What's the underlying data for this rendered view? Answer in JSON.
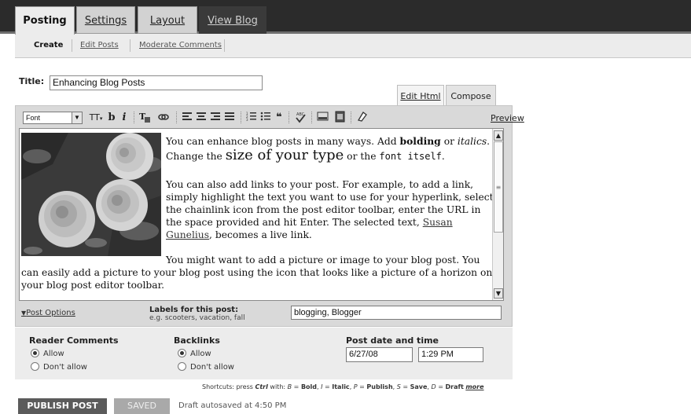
{
  "tabs": {
    "posting": "Posting",
    "settings": "Settings",
    "layout": "Layout",
    "view_blog": "View Blog"
  },
  "subtabs": {
    "create": "Create",
    "edit_posts": "Edit Posts",
    "moderate_comments": "Moderate Comments"
  },
  "title_field": {
    "label": "Title:",
    "value": "Enhancing Blog Posts"
  },
  "editor_modes": {
    "edit_html": "Edit Html",
    "compose": "Compose"
  },
  "toolbar": {
    "font_label": "Font",
    "font_size_icon": "TT",
    "bold": "b",
    "italic": "i",
    "preview": "Preview",
    "icons": [
      "font-select-icon",
      "font-size-icon",
      "bold-icon",
      "italic-icon",
      "text-color-icon",
      "link-icon",
      "align-left-icon",
      "align-center-icon",
      "align-right-icon",
      "justify-icon",
      "numbered-list-icon",
      "bullet-list-icon",
      "blockquote-icon",
      "spellcheck-icon",
      "image-icon",
      "video-icon",
      "remove-formatting-icon"
    ]
  },
  "content": {
    "p1_line1_a": "You can enhance blog posts in many ways. Add ",
    "p1_bold": "bolding",
    "p1_line1_b": " or ",
    "p1_italic": "italics",
    "p1_line1_c": ".",
    "p1_line2_a": "Change the ",
    "p1_big": "size of your type",
    "p1_line2_b": " or the ",
    "p1_mono": "font itself",
    "p1_line2_c": ".",
    "p2_line1": "You can also add links to your post. For example, to add a link,",
    "p2_line2": "simply highlight the text you want to use for your hyperlink, select",
    "p2_line3": "the chainlink icon from the post editor toolbar, enter the URL in",
    "p2_line4_a": "the space provided and hit Enter.  The selected text, ",
    "p2_link_a": "Susan",
    "p2_link_b": "Gunelius",
    "p2_line5_b": ", becomes a live link.",
    "p3_line1": "You might want to add a picture or image to your blog post. You",
    "p3_line2": "can easily add a picture to your blog post using the icon that looks like a picture of a horizon on",
    "p3_line3": "your blog post editor toolbar."
  },
  "labels": {
    "post_options": "Post Options",
    "title": "Labels for this post:",
    "hint": "e.g. scooters, vacation, fall",
    "value": "blogging, Blogger"
  },
  "options": {
    "reader_comments": {
      "heading": "Reader Comments",
      "allow": "Allow",
      "dont_allow": "Don't allow",
      "selected": "Allow"
    },
    "backlinks": {
      "heading": "Backlinks",
      "allow": "Allow",
      "dont_allow": "Don't allow",
      "selected": "Allow"
    },
    "post_date_time": {
      "heading": "Post date and time",
      "date": "6/27/08",
      "time": "1:29 PM"
    }
  },
  "shortcuts": {
    "prefix": "Shortcuts: press ",
    "key": "Ctrl",
    "mid": " with: ",
    "b_key": "B",
    "b_label": "Bold",
    "i_key": "I",
    "i_label": "Italic",
    "p_key": "P",
    "p_label": "Publish",
    "s_key": "S",
    "s_label": "Save",
    "d_key": "D",
    "d_label": "Draft",
    "more": "more"
  },
  "footer": {
    "publish": "PUBLISH POST",
    "saved": "SAVED",
    "autosave": "Draft autosaved at 4:50 PM"
  }
}
